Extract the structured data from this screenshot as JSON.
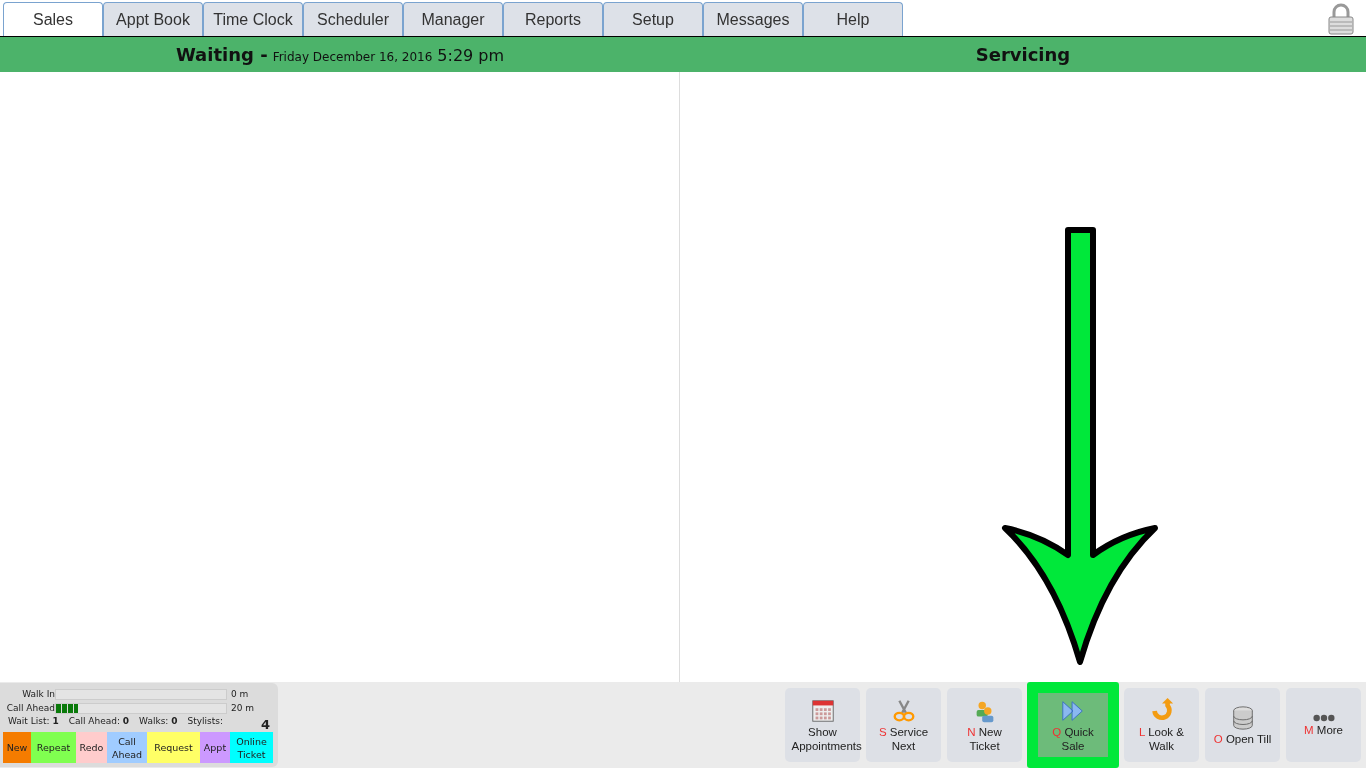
{
  "tabs": [
    {
      "label": "Sales",
      "selected": true
    },
    {
      "label": "Appt Book",
      "selected": false
    },
    {
      "label": "Time Clock",
      "selected": false
    },
    {
      "label": "Scheduler",
      "selected": false
    },
    {
      "label": "Manager",
      "selected": false
    },
    {
      "label": "Reports",
      "selected": false
    },
    {
      "label": "Setup",
      "selected": false
    },
    {
      "label": "Messages",
      "selected": false
    },
    {
      "label": "Help",
      "selected": false
    }
  ],
  "header": {
    "waiting_label": "Waiting -",
    "date": "Friday December 16, 2016",
    "time": "5:29 pm",
    "servicing_label": "Servicing"
  },
  "queue_panel": {
    "bars": [
      {
        "label": "Walk In",
        "reading": "0 m"
      },
      {
        "label": "Call Ahead",
        "level": 0.13,
        "reading": "20 m"
      }
    ],
    "stats": [
      {
        "label": "Wait List:",
        "value": "1"
      },
      {
        "label": "Call Ahead:",
        "value": "0"
      },
      {
        "label": "Walks:",
        "value": "0"
      },
      {
        "label": "Stylists:"
      }
    ],
    "stylists_count": "4",
    "legend": [
      {
        "label": "New",
        "color": "#f57c00"
      },
      {
        "label": "Repeat",
        "color": "#80ff50"
      },
      {
        "label": "Redo",
        "color": "#ffcccc"
      },
      {
        "label": "Call Ahead",
        "color": "#a0ccff"
      },
      {
        "label": "Request",
        "color": "#ffff66"
      },
      {
        "label": "Appt",
        "color": "#cc99ff"
      },
      {
        "label": "Online Ticket",
        "color": "#00ffff"
      }
    ]
  },
  "actions": [
    {
      "kind": "calendar",
      "label": "Show Appointments",
      "highlighted": false
    },
    {
      "kind": "scissors",
      "hotkey": "S",
      "label": "Service Next",
      "highlighted": false
    },
    {
      "kind": "people",
      "hotkey": "N",
      "label": "New Ticket",
      "highlighted": false
    },
    {
      "kind": "forward",
      "hotkey": "Q",
      "label": "Quick Sale",
      "highlighted": true
    },
    {
      "kind": "uturn",
      "hotkey": "L",
      "label": "Look & Walk",
      "highlighted": false
    },
    {
      "kind": "database",
      "hotkey": "O",
      "label": "Open Till",
      "highlighted": false
    },
    {
      "kind": "dots",
      "hotkey": "M",
      "label": "More",
      "highlighted": false
    }
  ]
}
